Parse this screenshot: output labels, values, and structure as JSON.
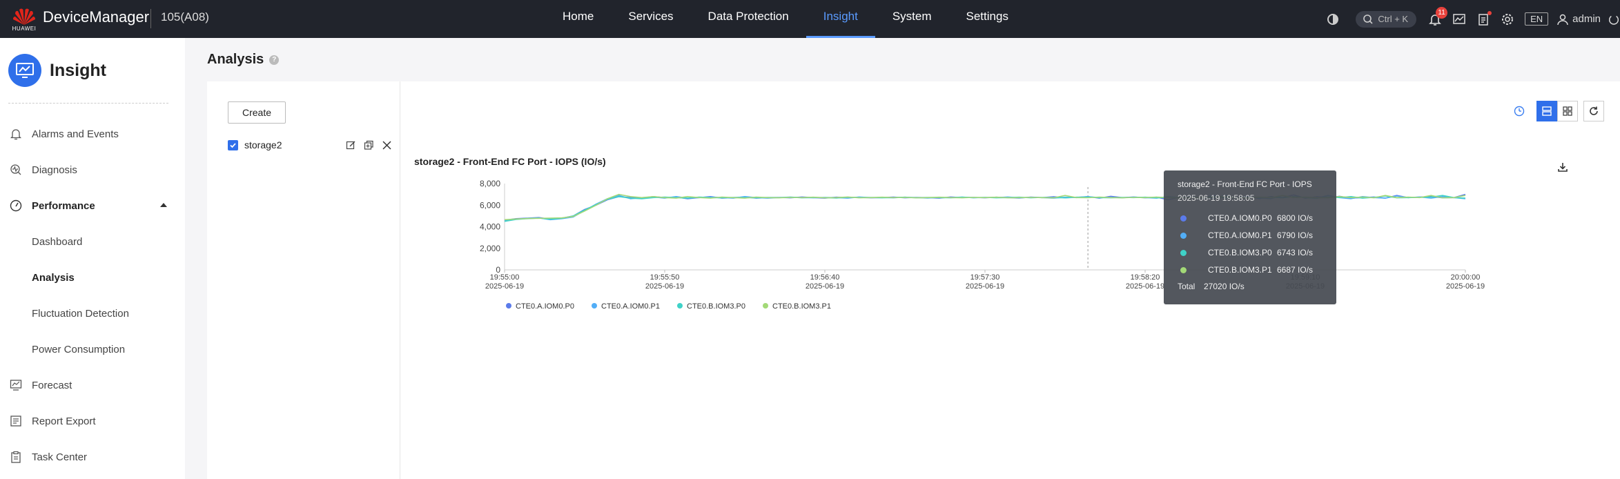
{
  "brand": {
    "logo_text": "HUAWEI",
    "app_name": "DeviceManager",
    "device": "105(A08)"
  },
  "nav": [
    {
      "label": "Home",
      "active": false
    },
    {
      "label": "Services",
      "active": false
    },
    {
      "label": "Data Protection",
      "active": false
    },
    {
      "label": "Insight",
      "active": true
    },
    {
      "label": "System",
      "active": false
    },
    {
      "label": "Settings",
      "active": false
    }
  ],
  "topbar": {
    "search_shortcut": "Ctrl + K",
    "alarm_count": "11",
    "language": "EN",
    "user": "admin"
  },
  "sidebar": {
    "title": "Insight",
    "items": [
      {
        "label": "Alarms and Events",
        "icon": "bell-icon"
      },
      {
        "label": "Diagnosis",
        "icon": "diagnosis-icon"
      },
      {
        "label": "Performance",
        "icon": "gauge-icon"
      },
      {
        "label": "Dashboard"
      },
      {
        "label": "Analysis"
      },
      {
        "label": "Fluctuation Detection"
      },
      {
        "label": "Power Consumption"
      },
      {
        "label": "Forecast",
        "icon": "forecast-icon"
      },
      {
        "label": "Report Export",
        "icon": "report-icon"
      },
      {
        "label": "Task Center",
        "icon": "clipboard-icon"
      }
    ],
    "active_sub": "Analysis"
  },
  "page": {
    "title": "Analysis",
    "help": "?"
  },
  "left_pane": {
    "create_label": "Create",
    "view_name": "storage2",
    "view_checked": true
  },
  "chart_data": {
    "type": "line",
    "title": "storage2 - Front-End FC Port - IOPS (IO/s)",
    "ylim": [
      0,
      8000
    ],
    "yticks": [
      "8,000",
      "6,000",
      "4,000",
      "2,000",
      "0"
    ],
    "ytick_values": [
      8000,
      6000,
      4000,
      2000,
      0
    ],
    "xticks": [
      {
        "time": "19:55:00",
        "date": "2025-06-19"
      },
      {
        "time": "19:55:50",
        "date": "2025-06-19"
      },
      {
        "time": "19:56:40",
        "date": "2025-06-19"
      },
      {
        "time": "19:57:30",
        "date": "2025-06-19"
      },
      {
        "time": "19:58:20",
        "date": "2025-06-19"
      },
      {
        "time": "19:59:10",
        "date": "2025-06-19"
      },
      {
        "time": "20:00:00",
        "date": "2025-06-19"
      }
    ],
    "grid": false,
    "legend_position": "bottom-left",
    "series": [
      {
        "name": "CTE0.A.IOM0.P0",
        "color": "#5b7bea",
        "values": [
          4600,
          4750,
          4800,
          4850,
          4700,
          4800,
          5000,
          5600,
          6000,
          6500,
          6800,
          6700,
          6650,
          6800,
          6700,
          6750,
          6600,
          6700,
          6800,
          6650,
          6700,
          6750,
          6650,
          6700,
          6720,
          6680,
          6760,
          6700,
          6650,
          6740,
          6700,
          6720,
          6680,
          6700,
          6750,
          6680,
          6720,
          6700,
          6650,
          6760,
          6700,
          6720,
          6680,
          6740,
          6700,
          6660,
          6750,
          6700,
          6780,
          6680,
          6720,
          6800,
          6650,
          6820,
          6700,
          6760,
          6680,
          6740,
          6500,
          6720,
          6800,
          6650,
          6900,
          6680,
          6720,
          6850,
          6600,
          6800,
          6700,
          6950,
          6650,
          6780,
          6700,
          6820,
          6650,
          6700,
          6760,
          6650,
          6900,
          6700,
          6750,
          6800,
          6680,
          6700,
          7000
        ]
      },
      {
        "name": "CTE0.A.IOM0.P1",
        "color": "#52aef7",
        "values": [
          4550,
          4700,
          4780,
          4820,
          4650,
          4750,
          4900,
          5500,
          6100,
          6600,
          6900,
          6600,
          6700,
          6750,
          6650,
          6800,
          6650,
          6700,
          6750,
          6700,
          6650,
          6800,
          6700,
          6650,
          6700,
          6750,
          6700,
          6680,
          6720,
          6700,
          6650,
          6760,
          6700,
          6720,
          6680,
          6740,
          6700,
          6660,
          6720,
          6700,
          6750,
          6680,
          6720,
          6700,
          6760,
          6680,
          6720,
          6700,
          6650,
          6740,
          6700,
          6790,
          6700,
          6720,
          6680,
          6750,
          6700,
          6650,
          6800,
          6700,
          6750,
          6700,
          6650,
          6900,
          6700,
          6750,
          6680,
          6600,
          6900,
          6700,
          6750,
          6650,
          6900,
          6700,
          6600,
          6800,
          6700,
          6650,
          6850,
          6700,
          6760,
          6650,
          6800,
          6700,
          6600
        ]
      },
      {
        "name": "CTE0.B.IOM3.P0",
        "color": "#3fd2c8",
        "values": [
          4500,
          4680,
          4750,
          4800,
          4700,
          4780,
          5000,
          5550,
          6050,
          6550,
          6800,
          6650,
          6600,
          6700,
          6750,
          6700,
          6650,
          6750,
          6700,
          6680,
          6720,
          6700,
          6680,
          6720,
          6700,
          6740,
          6680,
          6720,
          6700,
          6660,
          6740,
          6700,
          6720,
          6680,
          6700,
          6740,
          6680,
          6720,
          6700,
          6680,
          6740,
          6700,
          6720,
          6680,
          6700,
          6740,
          6680,
          6720,
          6700,
          6680,
          6740,
          6743,
          6700,
          6680,
          6720,
          6700,
          6740,
          6680,
          6720,
          6700,
          6740,
          6680,
          6800,
          6700,
          6680,
          6750,
          6700,
          6740,
          6680,
          6800,
          6700,
          6650,
          6750,
          6700,
          6800,
          6650,
          6720,
          6850,
          6680,
          6700,
          6720,
          6750,
          6900,
          6700,
          6650
        ]
      },
      {
        "name": "CTE0.B.IOM3.P1",
        "color": "#a3d977",
        "values": [
          4650,
          4720,
          4760,
          4780,
          4800,
          4820,
          4950,
          5450,
          6000,
          6600,
          7000,
          6800,
          6700,
          6800,
          6700,
          6650,
          6800,
          6700,
          6650,
          6750,
          6700,
          6650,
          6750,
          6700,
          6680,
          6720,
          6700,
          6740,
          6680,
          6700,
          6760,
          6680,
          6700,
          6740,
          6700,
          6720,
          6680,
          6700,
          6740,
          6700,
          6680,
          6720,
          6700,
          6740,
          6680,
          6700,
          6720,
          6700,
          6680,
          6900,
          6700,
          6687,
          6750,
          6700,
          6680,
          6720,
          6700,
          6750,
          6700,
          6680,
          6720,
          6700,
          6750,
          6800,
          6700,
          6680,
          6750,
          6700,
          6900,
          6700,
          6750,
          6700,
          6680,
          6800,
          6700,
          6750,
          6680,
          6900,
          6700,
          6750,
          6700,
          6900,
          6680,
          6700,
          6900
        ]
      }
    ],
    "tooltip": {
      "title": "storage2 - Front-End FC Port - IOPS",
      "time": "2025-06-19 19:58:05",
      "rows": [
        {
          "name": "CTE0.A.IOM0.P0",
          "value": "6800 IO/s",
          "color": "#5b7bea"
        },
        {
          "name": "CTE0.A.IOM0.P1",
          "value": "6790 IO/s",
          "color": "#52aef7"
        },
        {
          "name": "CTE0.B.IOM3.P0",
          "value": "6743 IO/s",
          "color": "#3fd2c8"
        },
        {
          "name": "CTE0.B.IOM3.P1",
          "value": "6687 IO/s",
          "color": "#a3d977"
        }
      ],
      "total_label": "Total",
      "total_value": "27020 IO/s",
      "hover_index": 51
    }
  }
}
